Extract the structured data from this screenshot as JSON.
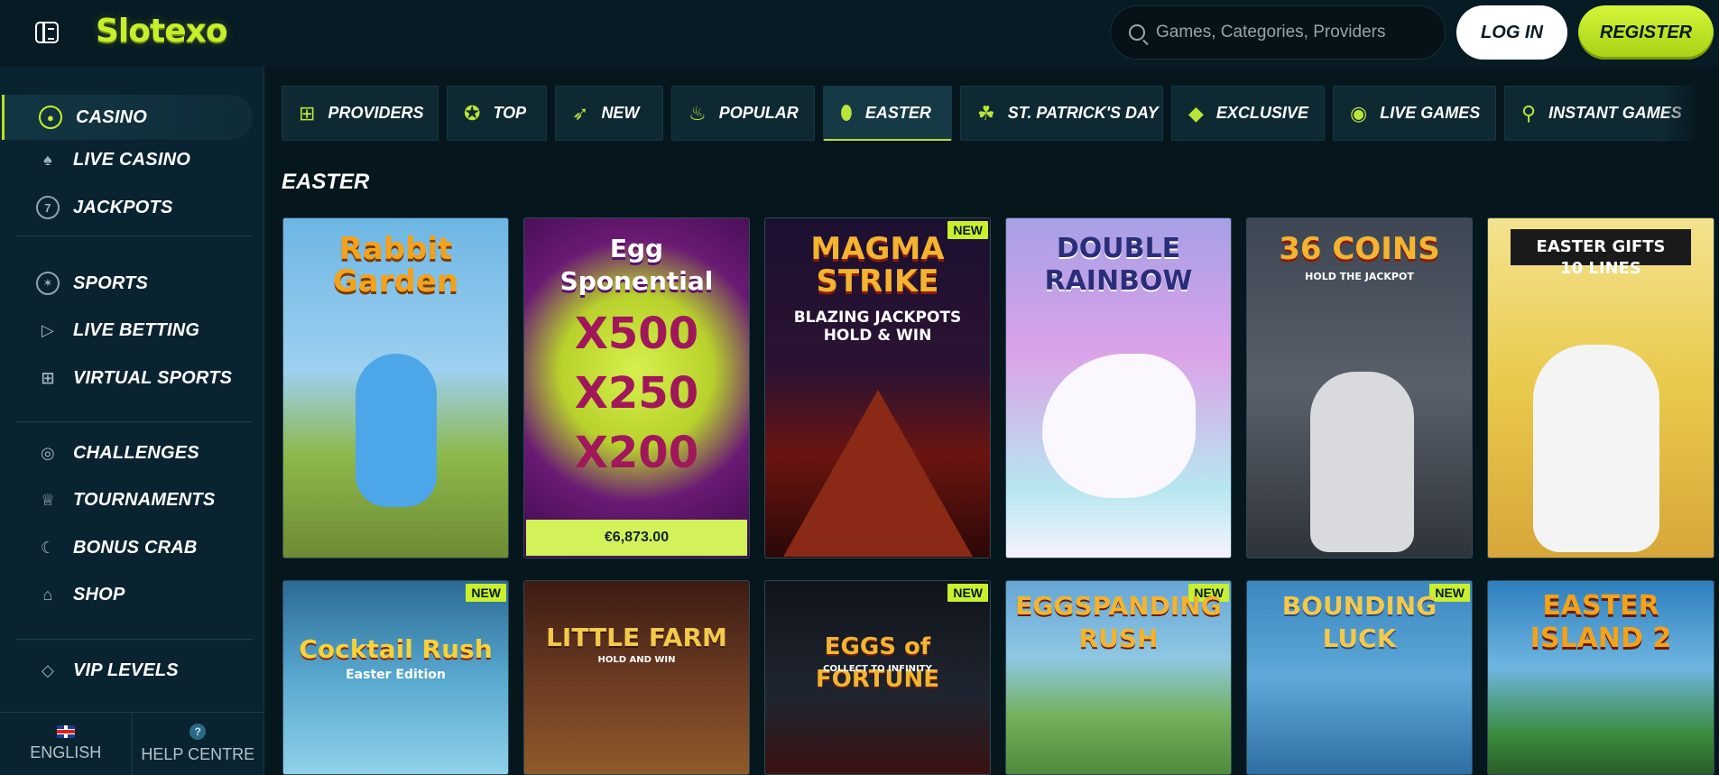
{
  "header": {
    "logo_text": "Slotexo",
    "search_placeholder": "Games, Categories, Providers",
    "login_label": "LOG IN",
    "register_label": "REGISTER"
  },
  "sidebar": {
    "items": [
      {
        "label": "CASINO",
        "icon": "casino-chip-icon",
        "active": true
      },
      {
        "label": "LIVE CASINO",
        "icon": "spade-icon"
      },
      {
        "label": "JACKPOTS",
        "icon": "seven-icon"
      },
      {
        "label": "SPORTS",
        "icon": "ball-icon"
      },
      {
        "label": "LIVE BETTING",
        "icon": "play-icon"
      },
      {
        "label": "VIRTUAL SPORTS",
        "icon": "gamepad-icon"
      },
      {
        "label": "CHALLENGES",
        "icon": "medal-icon"
      },
      {
        "label": "TOURNAMENTS",
        "icon": "trophy-icon"
      },
      {
        "label": "BONUS CRAB",
        "icon": "crab-icon"
      },
      {
        "label": "SHOP",
        "icon": "shop-icon"
      },
      {
        "label": "VIP LEVELS",
        "icon": "diamond-icon"
      }
    ],
    "footer": {
      "language_label": "ENGLISH",
      "help_label": "HELP CENTRE"
    }
  },
  "tabs": [
    {
      "label": "PROVIDERS",
      "icon": "grid-icon"
    },
    {
      "label": "TOP",
      "icon": "badge-icon"
    },
    {
      "label": "NEW",
      "icon": "rocket-icon"
    },
    {
      "label": "POPULAR",
      "icon": "flame-icon"
    },
    {
      "label": "EASTER",
      "icon": "egg-icon",
      "active": true
    },
    {
      "label": "ST. PATRICK'S DAY",
      "icon": "clover-icon"
    },
    {
      "label": "EXCLUSIVE",
      "icon": "diamond-icon"
    },
    {
      "label": "LIVE GAMES",
      "icon": "broadcast-icon"
    },
    {
      "label": "INSTANT GAMES",
      "icon": "joystick-icon"
    }
  ],
  "section_title": "EASTER",
  "games": [
    {
      "title": "Rabbit Garden",
      "title_color": "#f3a21b",
      "new": false
    },
    {
      "title": "Egg Sponential",
      "title_color": "#ffffff",
      "sub": "X500 X250 X200",
      "jackpot": "€6,873.00",
      "new": false
    },
    {
      "title": "MAGMA STRIKE",
      "title_color": "#f2b431",
      "sub": "BLAZING JACKPOTS HOLD & WIN",
      "new": true
    },
    {
      "title": "DOUBLE RAINBOW",
      "title_color": "#2a2e7a",
      "new": false
    },
    {
      "title": "36 COINS",
      "title_color": "#f2b431",
      "sub": "HOLD THE JACKPOT",
      "new": false
    },
    {
      "title": "EASTER GIFTS",
      "title_color": "#ffffff",
      "sub": "10 LINES",
      "new": false
    },
    {
      "title": "Cocktail Rush",
      "title_color": "#f5d33a",
      "sub": "Easter Edition",
      "new": true
    },
    {
      "title": "LITTLE FARM",
      "title_color": "#f2c94c",
      "sub": "HOLD AND WIN",
      "new": false
    },
    {
      "title": "EGGS of FORTUNE",
      "title_color": "#f2b431",
      "sub": "COLLECT TO INFINITY",
      "new": true
    },
    {
      "title": "EGGSPANDING RUSH",
      "title_color": "#f2b431",
      "new": true
    },
    {
      "title": "BOUNDING LUCK",
      "title_color": "#f2c94c",
      "new": true
    },
    {
      "title": "EASTER ISLAND 2",
      "title_color": "#f2a21b",
      "new": false
    }
  ],
  "new_badge_label": "NEW",
  "colors": {
    "accent": "#c6ef2c",
    "background": "#06161d",
    "sidebar": "#0a2330"
  }
}
